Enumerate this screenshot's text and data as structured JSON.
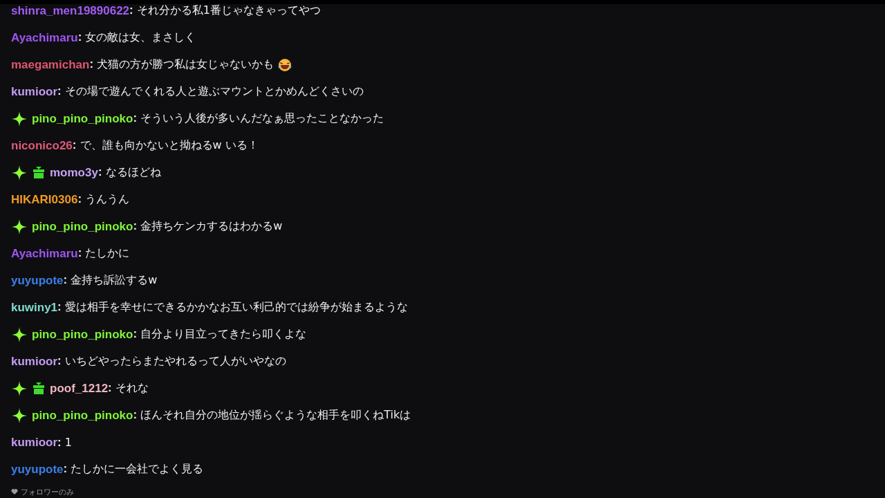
{
  "messages": [
    {
      "user": "shinra_men19890622",
      "color": "#a35cf5",
      "text": "**:** それ分かる私1番じゃなきゃってやつ"
    },
    {
      "user": "Ayachimaru",
      "color": "#9e55f2",
      "text": "**:** 女の敵は女、まさしく"
    },
    {
      "user": "maegamichan",
      "color": "#e0566f",
      "text": "**:** 犬猫の方が勝つ私は女じゃないかも",
      "emoji": true
    },
    {
      "user": "kumioor",
      "color": "#c49cf2",
      "text": "**:** その場で遊んでくれる人と遊ぶマウントとかめんどくさいの"
    },
    {
      "user": "pino_pino_pinoko",
      "color": "#7ff53a",
      "badges": [
        {
          "kind": "sparkle"
        }
      ],
      "text": "**:** そういう人後が多いんだなぁ思ったことなかった"
    },
    {
      "user": "niconico26",
      "color": "#e05a78",
      "text": "**:** で、誰も向かないと拗ねるw いる！"
    },
    {
      "user": "momo3y",
      "color": "#c7a2f5",
      "badges": [
        {
          "kind": "sparkle"
        },
        {
          "kind": "gift"
        }
      ],
      "text": "**:** なるほどね"
    },
    {
      "user": "HIKARI0306",
      "color": "#f09a22",
      "text": "**:** うんうん"
    },
    {
      "user": "pino_pino_pinoko",
      "color": "#7ff53a",
      "badges": [
        {
          "kind": "sparkle"
        }
      ],
      "text": "**:** 金持ちケンカするはわかるw"
    },
    {
      "user": "Ayachimaru",
      "color": "#9e55f2",
      "text": "**:** たしかに"
    },
    {
      "user": "yuyupote",
      "color": "#3a7fe8",
      "text": "**:** 金持ち訴訟するw"
    },
    {
      "user": "kuwiny1",
      "color": "#7fdccf",
      "text": "**:** 愛は相手を幸せにできるかかなお互い利己的では紛争が始まるような"
    },
    {
      "user": "pino_pino_pinoko",
      "color": "#7ff53a",
      "badges": [
        {
          "kind": "sparkle"
        }
      ],
      "text": "**:** 自分より目立ってきたら叩くよな"
    },
    {
      "user": "kumioor",
      "color": "#c49cf2",
      "text": "**:** いちどやったらまたやれるって人がいやなの"
    },
    {
      "user": "poof_1212",
      "color": "#f2b6c4",
      "badges": [
        {
          "kind": "sparkle"
        },
        {
          "kind": "gift"
        }
      ],
      "text": "**:** それな"
    },
    {
      "user": "pino_pino_pinoko",
      "color": "#7ff53a",
      "badges": [
        {
          "kind": "sparkle"
        }
      ],
      "text": "**:** ほんそれ自分の地位が揺らぐような相手を叩くねTikは"
    },
    {
      "user": "kumioor",
      "color": "#c49cf2",
      "text": "**:** 1"
    },
    {
      "user": "yuyupote",
      "color": "#3a7fe8",
      "text": "**:** たしかに一会社でよく見る"
    }
  ],
  "footer": {
    "text": "フォロワーのみ"
  }
}
